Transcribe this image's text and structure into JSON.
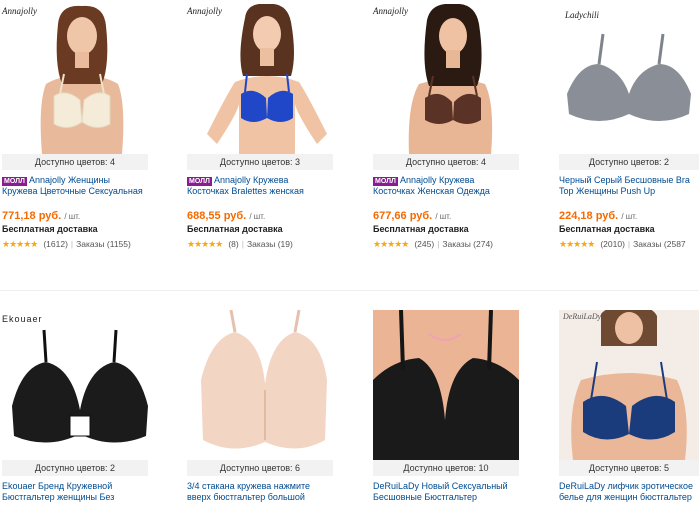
{
  "products": [
    {
      "brand": "Annajolly",
      "colors_label": "Доступно цветов: 4",
      "badge": "МОЛЛ",
      "title_line1": "Annajolly Женщины",
      "title_line2": "Кружева Цветочные Сексуальная",
      "price": "771,18 руб.",
      "unit": "/ шт.",
      "shipping": "Бесплатная доставка",
      "stars": "★★★★★",
      "reviews": "(1612)",
      "orders": "Заказы (1155)"
    },
    {
      "brand": "Annajolly",
      "colors_label": "Доступно цветов: 3",
      "badge": "МОЛЛ",
      "title_line1": "Annajolly Кружева",
      "title_line2": "Косточках Bralettes женская",
      "price": "688,55 руб.",
      "unit": "/ шт.",
      "shipping": "Бесплатная доставка",
      "stars": "★★★★★",
      "reviews": "(8)",
      "orders": "Заказы (19)"
    },
    {
      "brand": "Annajolly",
      "colors_label": "Доступно цветов: 4",
      "badge": "МОЛЛ",
      "title_line1": "Annajolly Кружева",
      "title_line2": "Косточках Женская Одежда",
      "price": "677,66 руб.",
      "unit": "/ шт.",
      "shipping": "Бесплатная доставка",
      "stars": "★★★★★",
      "reviews": "(245)",
      "orders": "Заказы (274)"
    },
    {
      "brand": "Ladychili",
      "colors_label": "Доступно цветов: 2",
      "badge": "",
      "title_line1": "Черный Серый Бесшовные Bra",
      "title_line2": "Top Женщины Push Up",
      "price": "224,18 руб.",
      "unit": "/ шт.",
      "shipping": "Бесплатная доставка",
      "stars": "★★★★★",
      "reviews": "(2010)",
      "orders": "Заказы (2587"
    },
    {
      "brand": "Ekouaer",
      "colors_label": "Доступно цветов: 2",
      "badge": "",
      "title_line1": "Ekouaer Бренд Кружевной",
      "title_line2": "Бюстгальтер женщины Без"
    },
    {
      "brand": "",
      "colors_label": "Доступно цветов: 6",
      "badge": "",
      "title_line1": "3/4 стакана кружева нажмите",
      "title_line2": "вверх бюстгальтер большой"
    },
    {
      "brand": "",
      "colors_label": "Доступно цветов: 10",
      "badge": "",
      "title_line1": "DeRuiLaDy Новый Сексуальный",
      "title_line2": "Бесшовные Бюстгальтер"
    },
    {
      "brand": "DeRuiLaDy",
      "colors_label": "Доступно цветов: 5",
      "badge": "",
      "title_line1": "DeRuiLaDy лифчик эротическое",
      "title_line2": "белье для женщин бюстгальтер"
    }
  ],
  "colors": {
    "price": "#f56a00",
    "title_link": "#004b91",
    "mall_badge": "#8a1c93",
    "star": "#f8a815",
    "colors_bar_bg": "#f2f2f2"
  }
}
